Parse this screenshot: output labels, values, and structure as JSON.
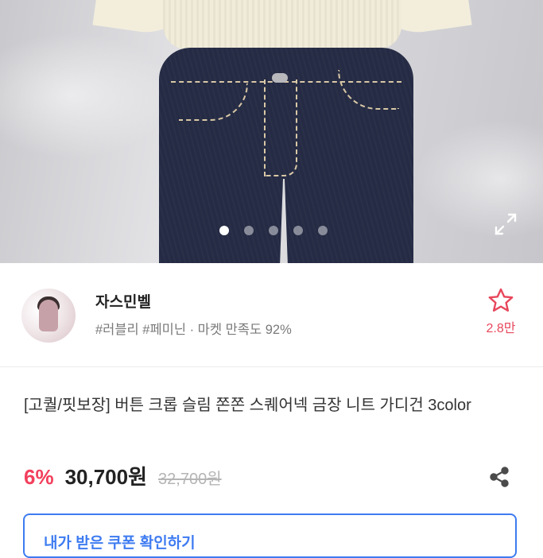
{
  "gallery": {
    "slide_count": 5,
    "active_slide_index": 0,
    "expand_icon": "expand-icon"
  },
  "seller": {
    "name": "자스민벨",
    "meta": "#러블리 #페미닌 · 마켓 만족도 92%",
    "favorite_icon": "star-outline-icon",
    "favorite_count": "2.8만"
  },
  "product": {
    "title": "[고퀄/핏보장] 버튼 크롭 슬림 쫀쫀 스퀘어넥 금장 니트 가디건 3color",
    "discount": "6%",
    "price": "30,700원",
    "original_price": "32,700원",
    "share_icon": "share-icon"
  },
  "coupon": {
    "label": "내가 받은 쿠폰 확인하기"
  },
  "colors": {
    "accent_red": "#f2405d",
    "favorite_pink": "#e8475c",
    "coupon_blue": "#3e7bf1"
  }
}
